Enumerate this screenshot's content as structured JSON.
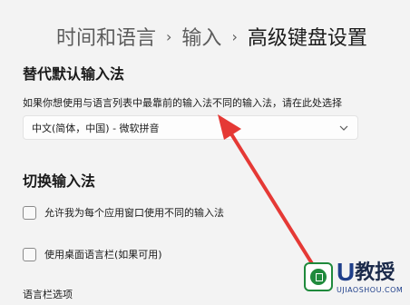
{
  "breadcrumb": {
    "parent": "时间和语言",
    "middle": "输入",
    "current": "高级键盘设置",
    "separator": "›"
  },
  "override_section": {
    "title": "替代默认输入法",
    "description": "如果你想使用与语言列表中最靠前的输入法不同的输入法，请在此处选择",
    "selected_value": "中文(简体，中国) - 微软拼音"
  },
  "switch_section": {
    "title": "切换输入法",
    "options": [
      {
        "label": "允许我为每个应用窗口使用不同的输入法",
        "checked": false
      },
      {
        "label": "使用桌面语言栏(如果可用)",
        "checked": false
      }
    ],
    "language_bar_link": "语言栏选项"
  },
  "watermark": {
    "letter": "U",
    "name": "教授",
    "url": "UJIAOSHOU.COM"
  },
  "colors": {
    "background": "#f3f3f3",
    "annotation_arrow": "#e53935",
    "watermark_green": "#1f8a3c",
    "watermark_blue": "#1f3f8a"
  }
}
